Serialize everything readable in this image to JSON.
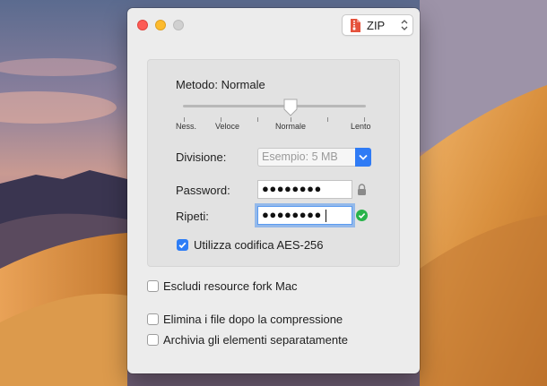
{
  "window": {
    "format_select": {
      "label": "ZIP",
      "icon": "zip-file-icon"
    }
  },
  "compression": {
    "method_label": "Metodo: Normale",
    "slider": {
      "levels": [
        "Ness.",
        "Veloce",
        "Normale",
        "Lento"
      ],
      "selected": "Normale"
    }
  },
  "split": {
    "label": "Divisione:",
    "placeholder": "Esempio: 5 MB"
  },
  "password": {
    "label": "Password:",
    "value": "●●●●●●●●"
  },
  "repeat": {
    "label": "Ripeti:",
    "value": "●●●●●●●●"
  },
  "aes": {
    "label": "Utilizza codifica AES-256",
    "checked": true
  },
  "options": [
    {
      "label": "Escludi resource fork Mac",
      "checked": false
    },
    {
      "label": "Elimina i file dopo la compressione",
      "checked": false
    },
    {
      "label": "Archivia gli elementi separatamente",
      "checked": false
    }
  ],
  "colors": {
    "accent": "#2d7df6",
    "valid": "#28b34a",
    "zip_icon": "#e5533d"
  }
}
